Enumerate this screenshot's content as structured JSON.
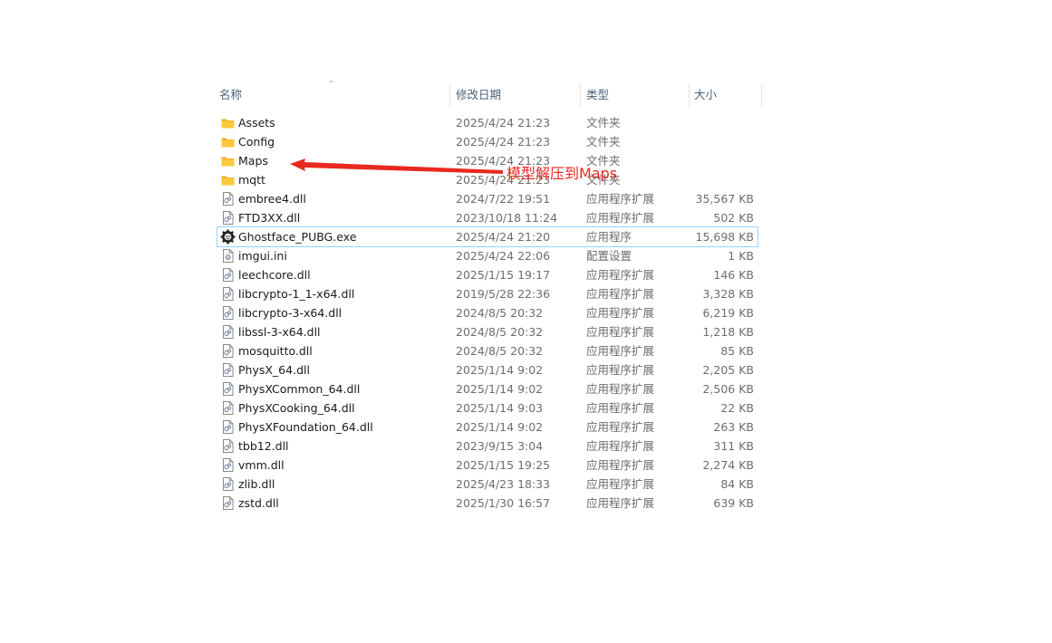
{
  "header": {
    "name": "名称",
    "date": "修改日期",
    "type": "类型",
    "size": "大小"
  },
  "files": [
    {
      "name": "Assets",
      "date": "2025/4/24 21:23",
      "type": "文件夹",
      "size": "",
      "icon": "folder-icon"
    },
    {
      "name": "Config",
      "date": "2025/4/24 21:23",
      "type": "文件夹",
      "size": "",
      "icon": "folder-icon"
    },
    {
      "name": "Maps",
      "date": "2025/4/24 21:23",
      "type": "文件夹",
      "size": "",
      "icon": "folder-icon"
    },
    {
      "name": "mqtt",
      "date": "2025/4/24 21:23",
      "type": "文件夹",
      "size": "",
      "icon": "folder-icon"
    },
    {
      "name": "embree4.dll",
      "date": "2024/7/22 19:51",
      "type": "应用程序扩展",
      "size": "35,567 KB",
      "icon": "dll-file-icon"
    },
    {
      "name": "FTD3XX.dll",
      "date": "2023/10/18 11:24",
      "type": "应用程序扩展",
      "size": "502 KB",
      "icon": "dll-file-icon"
    },
    {
      "name": "Ghostface_PUBG.exe",
      "date": "2025/4/24 21:20",
      "type": "应用程序",
      "size": "15,698 KB",
      "icon": "exe-gear-icon",
      "selected": true
    },
    {
      "name": "imgui.ini",
      "date": "2025/4/24 22:06",
      "type": "配置设置",
      "size": "1 KB",
      "icon": "ini-file-icon"
    },
    {
      "name": "leechcore.dll",
      "date": "2025/1/15 19:17",
      "type": "应用程序扩展",
      "size": "146 KB",
      "icon": "dll-file-icon"
    },
    {
      "name": "libcrypto-1_1-x64.dll",
      "date": "2019/5/28 22:36",
      "type": "应用程序扩展",
      "size": "3,328 KB",
      "icon": "dll-file-icon"
    },
    {
      "name": "libcrypto-3-x64.dll",
      "date": "2024/8/5 20:32",
      "type": "应用程序扩展",
      "size": "6,219 KB",
      "icon": "dll-file-icon"
    },
    {
      "name": "libssl-3-x64.dll",
      "date": "2024/8/5 20:32",
      "type": "应用程序扩展",
      "size": "1,218 KB",
      "icon": "dll-file-icon"
    },
    {
      "name": "mosquitto.dll",
      "date": "2024/8/5 20:32",
      "type": "应用程序扩展",
      "size": "85 KB",
      "icon": "dll-file-icon"
    },
    {
      "name": "PhysX_64.dll",
      "date": "2025/1/14 9:02",
      "type": "应用程序扩展",
      "size": "2,205 KB",
      "icon": "dll-file-icon"
    },
    {
      "name": "PhysXCommon_64.dll",
      "date": "2025/1/14 9:02",
      "type": "应用程序扩展",
      "size": "2,506 KB",
      "icon": "dll-file-icon"
    },
    {
      "name": "PhysXCooking_64.dll",
      "date": "2025/1/14 9:03",
      "type": "应用程序扩展",
      "size": "22 KB",
      "icon": "dll-file-icon"
    },
    {
      "name": "PhysXFoundation_64.dll",
      "date": "2025/1/14 9:02",
      "type": "应用程序扩展",
      "size": "263 KB",
      "icon": "dll-file-icon"
    },
    {
      "name": "tbb12.dll",
      "date": "2023/9/15 3:04",
      "type": "应用程序扩展",
      "size": "311 KB",
      "icon": "dll-file-icon"
    },
    {
      "name": "vmm.dll",
      "date": "2025/1/15 19:25",
      "type": "应用程序扩展",
      "size": "2,274 KB",
      "icon": "dll-file-icon"
    },
    {
      "name": "zlib.dll",
      "date": "2025/4/23 18:33",
      "type": "应用程序扩展",
      "size": "84 KB",
      "icon": "dll-file-icon"
    },
    {
      "name": "zstd.dll",
      "date": "2025/1/30 16:57",
      "type": "应用程序扩展",
      "size": "639 KB",
      "icon": "dll-file-icon"
    }
  ],
  "annotation": {
    "text": "模型解压到Maps",
    "color": "#e8291f"
  },
  "colors": {
    "folder": "#ffc83d",
    "header_text": "#4c607a",
    "selection_border": "#99d1ff"
  }
}
